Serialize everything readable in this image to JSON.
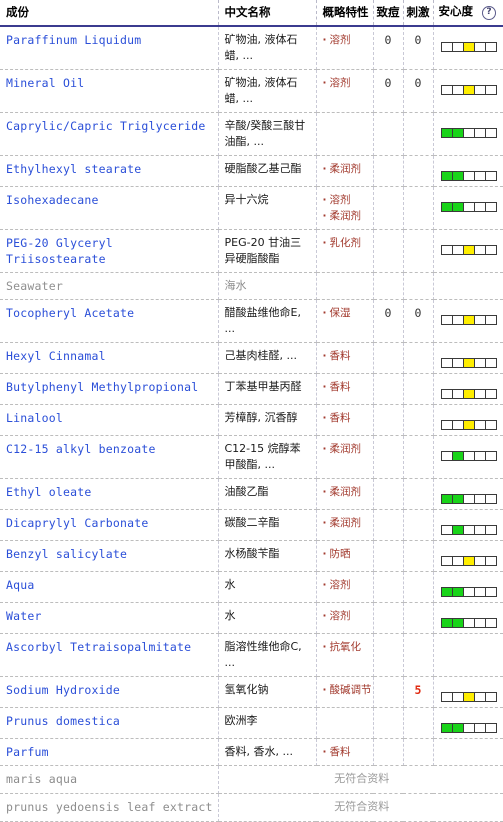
{
  "table": {
    "columns": {
      "name": "成份",
      "chinese_name": "中文名称",
      "properties": "概略特性",
      "acne": "致痘",
      "irritation": "刺激",
      "safety": "安心度",
      "help_icon": "question-mark-help-icon"
    },
    "no_data_message": "无符合资料",
    "meter_cells": 5,
    "colors": {
      "link": "#2b4fd8",
      "property_text": "#a23a2e",
      "alert_number": "#e02b12",
      "meter_green": "#19d419",
      "meter_yellow": "#ffee00",
      "muted": "#8d8d8d",
      "header_rule": "#3b3b8f"
    },
    "rows": [
      {
        "name": "Paraffinum Liquidum",
        "chinese": "矿物油, 液体石蜡, ...",
        "properties": [
          "溶剂"
        ],
        "acne": "0",
        "irritation": "0",
        "meter": [
          "off",
          "off",
          "yellow",
          "off",
          "off"
        ]
      },
      {
        "name": "Mineral Oil",
        "chinese": "矿物油, 液体石蜡, ...",
        "properties": [
          "溶剂"
        ],
        "acne": "0",
        "irritation": "0",
        "meter": [
          "off",
          "off",
          "yellow",
          "off",
          "off"
        ]
      },
      {
        "name": "Caprylic/Capric Triglyceride",
        "chinese": "辛酸/癸酸三酸甘油酯, ...",
        "properties": [],
        "acne": "",
        "irritation": "",
        "meter": [
          "green",
          "green",
          "off",
          "off",
          "off"
        ]
      },
      {
        "name": "Ethylhexyl stearate",
        "chinese": "硬脂酸乙基己酯",
        "properties": [
          "柔润剂"
        ],
        "acne": "",
        "irritation": "",
        "meter": [
          "green",
          "green",
          "off",
          "off",
          "off"
        ]
      },
      {
        "name": "Isohexadecane",
        "chinese": "异十六烷",
        "properties": [
          "溶剂",
          "柔润剂"
        ],
        "acne": "",
        "irritation": "",
        "meter": [
          "green",
          "green",
          "off",
          "off",
          "off"
        ]
      },
      {
        "name": "PEG-20 Glyceryl Triisostearate",
        "chinese": "PEG-20 甘油三异硬脂酸酯",
        "properties": [
          "乳化剂"
        ],
        "acne": "",
        "irritation": "",
        "meter": [
          "off",
          "off",
          "yellow",
          "off",
          "off"
        ]
      },
      {
        "name": "Seawater",
        "chinese": "海水",
        "properties": [],
        "acne": "",
        "irritation": "",
        "meter": [],
        "inactive": true,
        "chinese_muted": true
      },
      {
        "name": "Tocopheryl Acetate",
        "chinese": "醋酸盐维他命E, ...",
        "properties": [
          "保湿"
        ],
        "acne": "0",
        "irritation": "0",
        "meter": [
          "off",
          "off",
          "yellow",
          "off",
          "off"
        ]
      },
      {
        "name": "Hexyl Cinnamal",
        "chinese": "己基肉桂醛, ...",
        "properties": [
          "香料"
        ],
        "acne": "",
        "irritation": "",
        "meter": [
          "off",
          "off",
          "yellow",
          "off",
          "off"
        ]
      },
      {
        "name": "Butylphenyl Methylpropional",
        "chinese": "丁苯基甲基丙醛",
        "properties": [
          "香料"
        ],
        "acne": "",
        "irritation": "",
        "meter": [
          "off",
          "off",
          "yellow",
          "off",
          "off"
        ]
      },
      {
        "name": "Linalool",
        "chinese": "芳樟醇, 沉香醇",
        "properties": [
          "香料"
        ],
        "acne": "",
        "irritation": "",
        "meter": [
          "off",
          "off",
          "yellow",
          "off",
          "off"
        ]
      },
      {
        "name": "C12-15 alkyl benzoate",
        "chinese": "C12-15 烷醇苯甲酸酯, ...",
        "properties": [
          "柔润剂"
        ],
        "acne": "",
        "irritation": "",
        "meter": [
          "off",
          "green",
          "off",
          "off",
          "off"
        ]
      },
      {
        "name": "Ethyl oleate",
        "chinese": "油酸乙酯",
        "properties": [
          "柔润剂"
        ],
        "acne": "",
        "irritation": "",
        "meter": [
          "green",
          "green",
          "off",
          "off",
          "off"
        ]
      },
      {
        "name": "Dicaprylyl Carbonate",
        "chinese": "碳酸二辛酯",
        "properties": [
          "柔润剂"
        ],
        "acne": "",
        "irritation": "",
        "meter": [
          "off",
          "green",
          "off",
          "off",
          "off"
        ]
      },
      {
        "name": "Benzyl salicylate",
        "chinese": "水杨酸苄酯",
        "properties": [
          "防晒"
        ],
        "acne": "",
        "irritation": "",
        "meter": [
          "off",
          "off",
          "yellow",
          "off",
          "off"
        ]
      },
      {
        "name": "Aqua",
        "chinese": "水",
        "properties": [
          "溶剂"
        ],
        "acne": "",
        "irritation": "",
        "meter": [
          "green",
          "green",
          "off",
          "off",
          "off"
        ]
      },
      {
        "name": "Water",
        "chinese": "水",
        "properties": [
          "溶剂"
        ],
        "acne": "",
        "irritation": "",
        "meter": [
          "green",
          "green",
          "off",
          "off",
          "off"
        ]
      },
      {
        "name": "Ascorbyl Tetraisopalmitate",
        "chinese": "脂溶性维他命C, ...",
        "properties": [
          "抗氧化"
        ],
        "acne": "",
        "irritation": "",
        "meter": []
      },
      {
        "name": "Sodium Hydroxide",
        "chinese": "氢氧化钠",
        "properties": [
          "酸碱调节"
        ],
        "acne": "",
        "irritation": "5",
        "irritation_alert": true,
        "meter": [
          "off",
          "off",
          "yellow",
          "off",
          "off"
        ]
      },
      {
        "name": "Prunus domestica",
        "chinese": "欧洲李",
        "properties": [],
        "acne": "",
        "irritation": "",
        "meter": [
          "green",
          "green",
          "off",
          "off",
          "off"
        ]
      },
      {
        "name": "Parfum",
        "chinese": "香料, 香水, ...",
        "properties": [
          "香料"
        ],
        "acne": "",
        "irritation": "",
        "meter": []
      },
      {
        "name": "maris aqua",
        "no_data": true
      },
      {
        "name": "prunus yedoensis leaf extract",
        "no_data": true
      }
    ]
  }
}
